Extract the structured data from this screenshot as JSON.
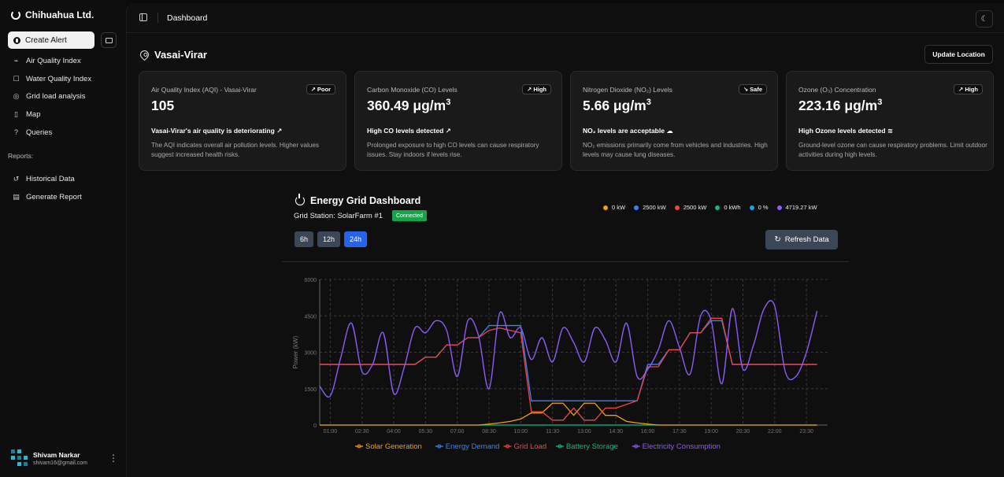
{
  "brand": "Chihuahua Ltd.",
  "sidebar": {
    "create_alert": "Create Alert",
    "items": [
      {
        "icon": "sparkle-icon",
        "glyph": "⌁",
        "label": "Air Quality Index"
      },
      {
        "icon": "cup-icon",
        "glyph": "☐",
        "label": "Water Quality Index"
      },
      {
        "icon": "target-icon",
        "glyph": "◎",
        "label": "Grid load analysis"
      },
      {
        "icon": "map-icon",
        "glyph": "▯",
        "label": "Map"
      },
      {
        "icon": "question-icon",
        "glyph": "?",
        "label": "Queries"
      }
    ],
    "reports_label": "Reports:",
    "reports": [
      {
        "icon": "history-icon",
        "glyph": "↺",
        "label": "Historical Data"
      },
      {
        "icon": "report-icon",
        "glyph": "▤",
        "label": "Generate Report"
      }
    ],
    "user": {
      "name": "Shivam Narkar",
      "email": "shivam16@gmail.com"
    }
  },
  "header": {
    "title": "Dashboard"
  },
  "location": {
    "name": "Vasai-Virar",
    "update_label": "Update Location"
  },
  "cards": [
    {
      "title": "Air Quality Index (AQI) - Vasai-Virar",
      "badge": "Poor",
      "value": "105",
      "unit": "",
      "sub": "Vasai-Virar's air quality is deteriorating",
      "sub_icon": "↗",
      "desc": "The AQI indicates overall air pollution levels. Higher values suggest increased health risks."
    },
    {
      "title": "Carbon Monoxide (CO) Levels",
      "badge": "High",
      "value": "360.49 μg/m",
      "unit": "3",
      "sub": "High CO levels detected",
      "sub_icon": "↗",
      "desc": "Prolonged exposure to high CO levels can cause respiratory issues. Stay indoors if levels rise."
    },
    {
      "title": "Nitrogen Dioxide (NO₂) Levels",
      "badge": "Safe",
      "value": "5.66 μg/m",
      "unit": "3",
      "sub": "NO₂ levels are acceptable",
      "sub_icon": "☁",
      "desc": "NO₂ emissions primarily come from vehicles and industries. High levels may cause lung diseases."
    },
    {
      "title": "Ozone (O₃) Concentration",
      "badge": "High",
      "value": "223.16 μg/m",
      "unit": "3",
      "sub": "High Ozone levels detected",
      "sub_icon": "≋",
      "desc": "Ground-level ozone can cause respiratory problems. Limit outdoor activities during high levels."
    }
  ],
  "energy": {
    "title": "Energy Grid Dashboard",
    "station": "Grid Station: SolarFarm #1",
    "status": "Connected",
    "stats": [
      {
        "color": "#f59e0b",
        "label": "0 kW"
      },
      {
        "color": "#3b82f6",
        "label": "2500 kW"
      },
      {
        "color": "#ef4444",
        "label": "2500 kW"
      },
      {
        "color": "#10b981",
        "label": "0 kWh"
      },
      {
        "color": "#0ea5e9",
        "label": "0 %"
      },
      {
        "color": "#8b5cf6",
        "label": "4719.27 kW"
      }
    ],
    "ranges": [
      "6h",
      "12h",
      "24h"
    ],
    "active_range": "24h",
    "refresh_label": "Refresh Data"
  },
  "chart_data": {
    "type": "line",
    "ylabel": "Power (kW)",
    "ylim": [
      0,
      6000
    ],
    "yticks": [
      0,
      1500,
      3000,
      4500,
      6000
    ],
    "x_tick_labels": [
      "01:00",
      "02:30",
      "04:00",
      "05:30",
      "07:00",
      "08:30",
      "10:00",
      "11:30",
      "13:00",
      "14:30",
      "16:00",
      "17:30",
      "19:00",
      "20:30",
      "22:00",
      "23:30"
    ],
    "x_hours": [
      0,
      0.5,
      1,
      1.5,
      2,
      2.5,
      3,
      3.5,
      4,
      4.5,
      5,
      5.5,
      6,
      6.5,
      7,
      7.5,
      8,
      8.5,
      9,
      9.5,
      10,
      10.5,
      11,
      11.5,
      12,
      12.5,
      13,
      13.5,
      14,
      14.5,
      15,
      15.5,
      16,
      16.5,
      17,
      17.5,
      18,
      18.5,
      19,
      19.5,
      20,
      20.5,
      21,
      21.5,
      22,
      22.5,
      23,
      23.5
    ],
    "series": [
      {
        "name": "Solar Generation",
        "color": "#f59e0b",
        "values": [
          0,
          0,
          0,
          0,
          0,
          0,
          0,
          0,
          0,
          0,
          0,
          0,
          0,
          0,
          0,
          0,
          40,
          90,
          150,
          250,
          500,
          500,
          900,
          900,
          400,
          900,
          900,
          400,
          400,
          150,
          90,
          40,
          0,
          0,
          0,
          0,
          0,
          0,
          0,
          0,
          0,
          0,
          0,
          0,
          0,
          0,
          0,
          0
        ]
      },
      {
        "name": "Energy Demand",
        "color": "#3b82f6",
        "values": [
          2500,
          2500,
          2500,
          2500,
          2500,
          2500,
          2500,
          2500,
          2500,
          2500,
          2800,
          2800,
          3300,
          3300,
          3600,
          3600,
          4100,
          4100,
          4100,
          4100,
          1000,
          1000,
          1000,
          1000,
          1000,
          1000,
          1000,
          1000,
          1000,
          1000,
          1000,
          2500,
          2500,
          3100,
          3100,
          3800,
          3800,
          4300,
          4300,
          2500,
          2500,
          2500,
          2500,
          2500,
          2500,
          2500,
          2500,
          2500
        ]
      },
      {
        "name": "Grid Load",
        "color": "#ef4444",
        "values": [
          2500,
          2500,
          2500,
          2500,
          2500,
          2500,
          2500,
          2500,
          2500,
          2500,
          2800,
          2800,
          3300,
          3300,
          3600,
          3600,
          3900,
          4000,
          3900,
          3800,
          550,
          550,
          200,
          200,
          700,
          200,
          200,
          700,
          700,
          850,
          1000,
          2400,
          2400,
          3100,
          3100,
          3800,
          3800,
          4400,
          4400,
          2500,
          2500,
          2500,
          2500,
          2500,
          2500,
          2500,
          2500,
          2500
        ]
      },
      {
        "name": "Battery Storage",
        "color": "#10b981",
        "values": [
          0,
          0,
          0,
          0,
          0,
          0,
          0,
          0,
          0,
          0,
          0,
          0,
          0,
          0,
          0,
          0,
          0,
          0,
          0,
          0,
          0,
          0,
          0,
          0,
          0,
          0,
          0,
          0,
          0,
          0,
          0,
          0,
          0,
          0,
          0,
          0,
          0,
          0,
          0,
          0,
          0,
          0,
          0,
          0,
          0,
          0,
          0,
          0
        ]
      },
      {
        "name": "Electricity Consumption",
        "color": "#8b5cf6",
        "values": [
          1600,
          1200,
          2800,
          4200,
          2200,
          2500,
          3800,
          1300,
          2400,
          4000,
          3800,
          4300,
          3900,
          2000,
          4300,
          3700,
          1500,
          4600,
          3600,
          4000,
          2700,
          3600,
          2600,
          4000,
          3400,
          2600,
          4000,
          3500,
          2600,
          4200,
          2000,
          2300,
          3100,
          4300,
          3200,
          2100,
          4500,
          4300,
          1700,
          4800,
          2300,
          3300,
          4800,
          4900,
          2200,
          2000,
          3000,
          4700
        ]
      }
    ]
  }
}
